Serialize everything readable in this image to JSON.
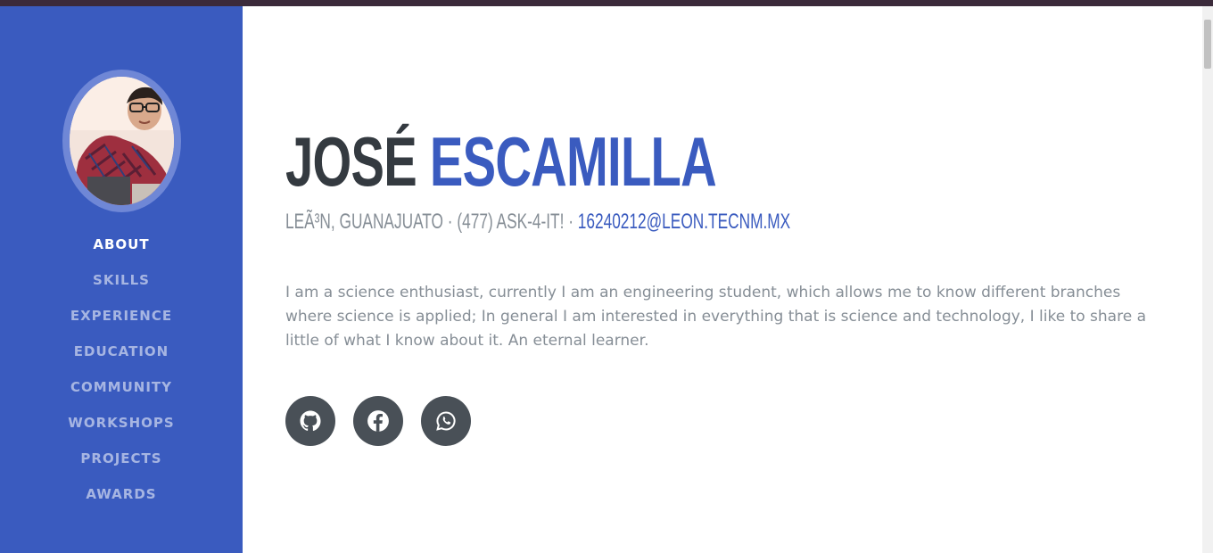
{
  "sidebar": {
    "nav": [
      {
        "label": "ABOUT",
        "active": true
      },
      {
        "label": "SKILLS"
      },
      {
        "label": "EXPERIENCE"
      },
      {
        "label": "EDUCATION"
      },
      {
        "label": "COMMUNITY"
      },
      {
        "label": "WORKSHOPS"
      },
      {
        "label": "PROJECTS"
      },
      {
        "label": "AWARDS"
      }
    ],
    "accent": "#3a5bbf"
  },
  "profile": {
    "first_name": "JOSÉ",
    "last_name": "ESCAMILLA",
    "location": "LEÃ³N, GUANAJUATO",
    "phone": "(477) ASK-4-IT!",
    "email": "16240212@LEON.TECNM.MX",
    "separator": " · ",
    "about": "I am a science enthusiast, currently I am an engineering student, which allows me to know different branches where science is applied; In general I am interested in everything that is science and technology, I like to share a little of what I know about it. An eternal learner."
  },
  "social": [
    {
      "icon": "github-icon"
    },
    {
      "icon": "facebook-icon"
    },
    {
      "icon": "whatsapp-icon"
    }
  ],
  "colors": {
    "heading": "#343a40",
    "muted": "#868e96",
    "social_bg": "#495057"
  }
}
